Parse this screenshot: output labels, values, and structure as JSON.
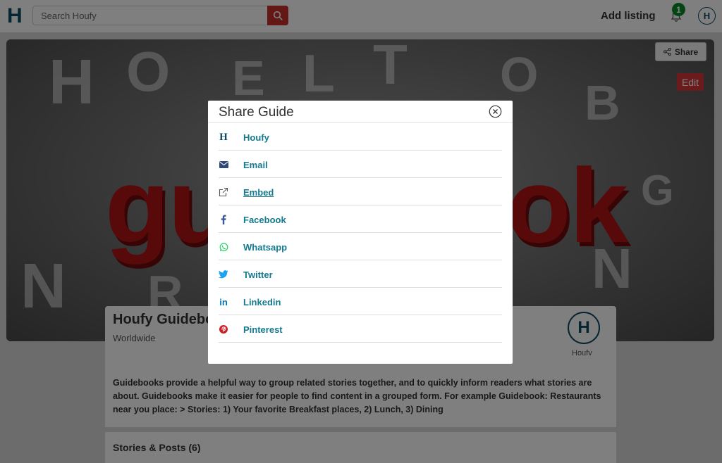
{
  "header": {
    "logo": "H",
    "search_placeholder": "Search Houfy",
    "add_listing": "Add listing",
    "notification_count": "1",
    "user_initial": "H"
  },
  "hero": {
    "word": "guidebook",
    "share_label": "Share",
    "edit_label": "Edit"
  },
  "guide": {
    "title": "Houfy Guidebook",
    "location": "Worldwide",
    "owner_initial": "H",
    "owner_name": "Houfy",
    "description": "Guidebooks provide a helpful way to group related stories together, and to quickly inform readers what stories are about. Guidebooks make it easier for people to find content in a grouped form. For example Guidebook: Restaurants near you place: > Stories: 1) Your favorite Breakfast places, 2) Lunch, 3) Dining",
    "stories_heading": "Stories & Posts (6)"
  },
  "modal": {
    "title": "Share Guide",
    "options": [
      {
        "label": "Houfy",
        "icon": "houfy-logo-icon",
        "color": "#0d4a63"
      },
      {
        "label": "Email",
        "icon": "envelope-icon",
        "color": "#2f4a7a"
      },
      {
        "label": "Embed",
        "icon": "external-link-icon",
        "color": "#555555"
      },
      {
        "label": "Facebook",
        "icon": "facebook-icon",
        "color": "#3b5998"
      },
      {
        "label": "Whatsapp",
        "icon": "whatsapp-icon",
        "color": "#25d366"
      },
      {
        "label": "Twitter",
        "icon": "twitter-icon",
        "color": "#1da1f2"
      },
      {
        "label": "Linkedin",
        "icon": "linkedin-icon",
        "color": "#0077b5"
      },
      {
        "label": "Pinterest",
        "icon": "pinterest-icon",
        "color": "#cb2027"
      }
    ]
  },
  "colors": {
    "brand": "#0d4a63",
    "link": "#137a8f",
    "search_button": "#c9302c",
    "edit_button": "#d9363a",
    "badge": "#0a8a2a"
  }
}
